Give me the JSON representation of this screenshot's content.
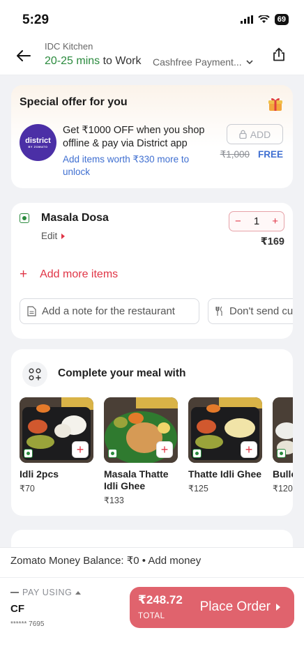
{
  "status_bar": {
    "time": "5:29",
    "battery": "69"
  },
  "header": {
    "restaurant": "IDC Kitchen",
    "eta": "20-25 mins",
    "destination": "to Work",
    "payment_method": "Cashfree Payment..."
  },
  "offer": {
    "title": "Special offer for you",
    "logo_text": "district",
    "logo_sub": "BY ZOMATO",
    "description": "Get ₹1000 OFF when you shop offline & pay via District app",
    "unlock_text": "Add items worth ₹330 more to unlock",
    "add_label": "ADD",
    "old_price": "₹1,000",
    "free_label": "FREE"
  },
  "cart": {
    "items": [
      {
        "name": "Masala Dosa",
        "edit_label": "Edit",
        "quantity": "1",
        "price": "₹169"
      }
    ],
    "add_more_label": "Add more items",
    "note_placeholder": "Add a note for the restaurant",
    "cutlery_label": "Don't send cutlery"
  },
  "complete_meal": {
    "title": "Complete your meal with",
    "items": [
      {
        "name": "Idli 2pcs",
        "price": "₹70"
      },
      {
        "name": "Masala Thatte Idli Ghee",
        "price": "₹133"
      },
      {
        "name": "Thatte Idli Ghee",
        "price": "₹125"
      },
      {
        "name": "Bulle",
        "price": "₹120"
      }
    ]
  },
  "footer": {
    "balance_text": "Zomato Money Balance: ₹0 • Add money",
    "pay_using_label": "PAY USING",
    "pay_code": "CF",
    "pay_mask": "****** 7695",
    "total": "₹248.72",
    "total_label": "TOTAL",
    "place_order_label": "Place Order"
  },
  "colors": {
    "brand_red": "#e03546",
    "button_red": "#e0636d",
    "green": "#2a8a3d",
    "blue": "#3f6fd1"
  }
}
